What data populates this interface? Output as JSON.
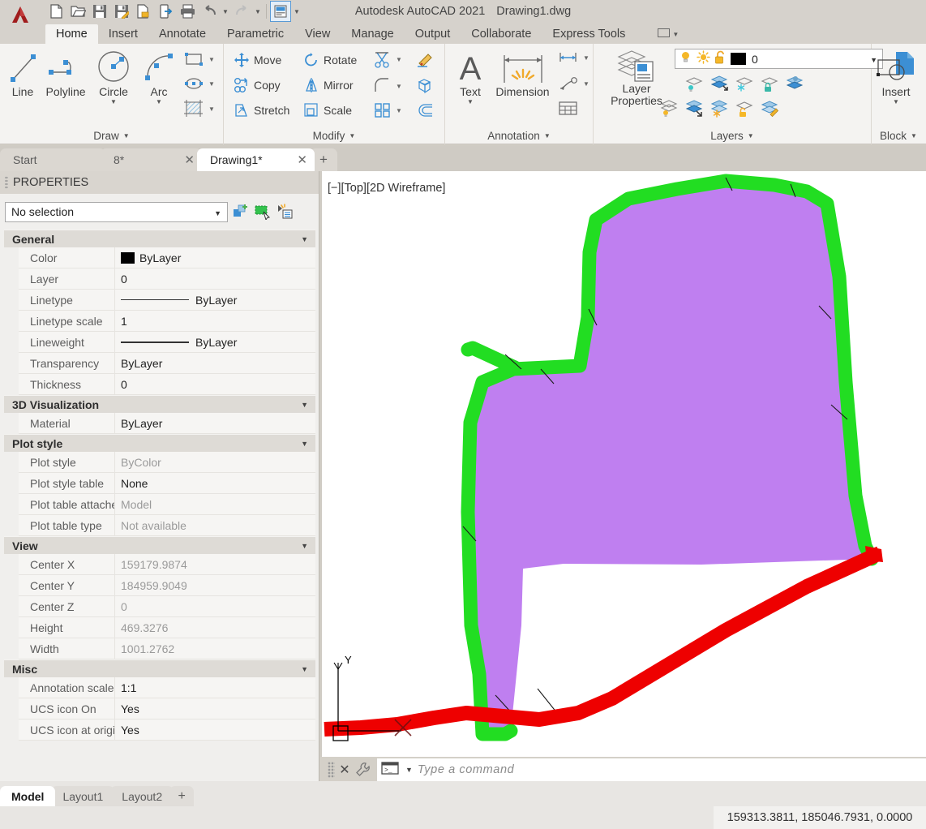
{
  "titlebar": {
    "logo": "autocad-logo",
    "product": "Autodesk AutoCAD 2021",
    "document": "Drawing1.dwg",
    "qat": [
      {
        "name": "new-icon",
        "tip": "New"
      },
      {
        "name": "open-icon",
        "tip": "Open"
      },
      {
        "name": "save-icon",
        "tip": "Save"
      },
      {
        "name": "saveas-icon",
        "tip": "Save As"
      },
      {
        "name": "save-to-web-icon",
        "tip": "Save to Web & Mobile"
      },
      {
        "name": "open-from-web-icon",
        "tip": "Open from Web & Mobile"
      },
      {
        "name": "plot-icon",
        "tip": "Plot"
      },
      {
        "name": "undo-icon",
        "tip": "Undo"
      },
      {
        "name": "redo-icon",
        "tip": "Redo"
      },
      {
        "name": "workspace-icon",
        "tip": "Workspace Switching"
      }
    ]
  },
  "ribbon": {
    "tabs": [
      {
        "label": "Home",
        "active": true
      },
      {
        "label": "Insert",
        "active": false
      },
      {
        "label": "Annotate",
        "active": false
      },
      {
        "label": "Parametric",
        "active": false
      },
      {
        "label": "View",
        "active": false
      },
      {
        "label": "Manage",
        "active": false
      },
      {
        "label": "Output",
        "active": false
      },
      {
        "label": "Collaborate",
        "active": false
      },
      {
        "label": "Express Tools",
        "active": false
      }
    ],
    "panels": [
      {
        "title": "Draw",
        "big_buttons": [
          {
            "label": "Line",
            "icon": "line-icon",
            "caret": false
          },
          {
            "label": "Polyline",
            "icon": "polyline-icon",
            "caret": false
          },
          {
            "label": "Circle",
            "icon": "circle-icon",
            "caret": true
          },
          {
            "label": "Arc",
            "icon": "arc-icon",
            "caret": true
          }
        ],
        "stack_buttons": [
          {
            "label": "",
            "icon": "rectangle-icon",
            "caret": true
          },
          {
            "label": "",
            "icon": "ellipse-icon",
            "caret": true
          },
          {
            "label": "",
            "icon": "hatch-icon",
            "caret": true
          }
        ]
      },
      {
        "title": "Modify",
        "small_buttons": [
          {
            "label": "Move",
            "icon": "move-icon"
          },
          {
            "label": "Rotate",
            "icon": "rotate-icon"
          },
          {
            "label": "Copy",
            "icon": "copy-icon"
          },
          {
            "label": "Mirror",
            "icon": "mirror-icon"
          },
          {
            "label": "Stretch",
            "icon": "stretch-icon"
          },
          {
            "label": "Scale",
            "icon": "scale-icon"
          }
        ],
        "icon_buttons": [
          {
            "icon": "trim-icon",
            "caret": true
          },
          {
            "icon": "fillet-icon",
            "caret": true
          },
          {
            "icon": "array-icon",
            "caret": true
          },
          {
            "icon": "erase-icon",
            "caret": false
          },
          {
            "icon": "explode-icon",
            "caret": false
          },
          {
            "icon": "offset-icon",
            "caret": false
          }
        ]
      },
      {
        "title": "Annotation",
        "big_buttons": [
          {
            "label": "Text",
            "icon": "text-icon",
            "caret": true
          },
          {
            "label": "Dimension",
            "icon": "dimension-icon",
            "caret": false
          }
        ],
        "icon_buttons": [
          {
            "icon": "linear-dimension-icon",
            "caret": true
          },
          {
            "icon": "leader-icon",
            "caret": true
          },
          {
            "icon": "table-icon",
            "caret": false
          }
        ]
      },
      {
        "title": "Layers",
        "big_buttons": [
          {
            "label": "Layer\nProperties",
            "icon": "layer-properties-icon",
            "caret": false
          }
        ],
        "layer_combo": {
          "name": "layer-selector",
          "value": "0",
          "color_swatch": "#000000",
          "state_icons": [
            "lightbulb-on-icon",
            "sun-icon",
            "unlock-icon"
          ]
        },
        "icon_buttons": [
          {
            "icon": "layer-isolate-icon"
          },
          {
            "icon": "layer-unisolate-icon"
          },
          {
            "icon": "layer-freeze-icon"
          },
          {
            "icon": "layer-lock-icon"
          },
          {
            "icon": "layer-merge-icon"
          },
          {
            "icon": "layer-off-icon"
          },
          {
            "icon": "layer-turn-all-on-icon"
          },
          {
            "icon": "layer-thaw-all-icon"
          },
          {
            "icon": "layer-unlock-icon"
          },
          {
            "icon": "layer-change-to-current-icon"
          }
        ]
      },
      {
        "title": "Block",
        "big_buttons": [
          {
            "label": "Insert",
            "icon": "insert-block-icon",
            "caret": true
          }
        ],
        "icon_buttons": [
          {
            "icon": "create-block-icon"
          },
          {
            "icon": "edit-block-icon"
          },
          {
            "icon": "define-attributes-icon"
          }
        ]
      }
    ]
  },
  "file_tabs": [
    {
      "label": "Start",
      "closable": false,
      "active": false
    },
    {
      "label": "8*",
      "closable": true,
      "active": false
    },
    {
      "label": "Drawing1*",
      "closable": true,
      "active": true
    }
  ],
  "file_tab_add": "+",
  "properties": {
    "title": "PROPERTIES",
    "selection": {
      "value": "No selection",
      "placeholder": "No selection"
    },
    "toolbar_icons": [
      "quick-select-icon",
      "select-objects-icon",
      "quick-properties-icon"
    ],
    "groups": [
      {
        "name": "General",
        "rows": [
          {
            "label": "Color",
            "value": "ByLayer",
            "kind": "color",
            "swatch": "#000000",
            "muted": false
          },
          {
            "label": "Layer",
            "value": "0",
            "kind": "text",
            "muted": false
          },
          {
            "label": "Linetype",
            "value": "ByLayer",
            "kind": "linetype",
            "muted": false
          },
          {
            "label": "Linetype scale",
            "value": "1",
            "kind": "text",
            "muted": false
          },
          {
            "label": "Lineweight",
            "value": "ByLayer",
            "kind": "lineweight",
            "muted": false
          },
          {
            "label": "Transparency",
            "value": "ByLayer",
            "kind": "text",
            "muted": false
          },
          {
            "label": "Thickness",
            "value": "0",
            "kind": "text",
            "muted": false
          }
        ]
      },
      {
        "name": "3D Visualization",
        "rows": [
          {
            "label": "Material",
            "value": "ByLayer",
            "kind": "text",
            "muted": false
          }
        ]
      },
      {
        "name": "Plot style",
        "rows": [
          {
            "label": "Plot style",
            "value": "ByColor",
            "kind": "text",
            "muted": true
          },
          {
            "label": "Plot style table",
            "value": "None",
            "kind": "text",
            "muted": false
          },
          {
            "label": "Plot table attached...",
            "value": "Model",
            "kind": "text",
            "muted": true
          },
          {
            "label": "Plot table type",
            "value": "Not available",
            "kind": "text",
            "muted": true
          }
        ]
      },
      {
        "name": "View",
        "rows": [
          {
            "label": "Center X",
            "value": "159179.9874",
            "kind": "text",
            "muted": true
          },
          {
            "label": "Center Y",
            "value": "184959.9049",
            "kind": "text",
            "muted": true
          },
          {
            "label": "Center Z",
            "value": "0",
            "kind": "text",
            "muted": true
          },
          {
            "label": "Height",
            "value": "469.3276",
            "kind": "text",
            "muted": true
          },
          {
            "label": "Width",
            "value": "1001.2762",
            "kind": "text",
            "muted": true
          }
        ]
      },
      {
        "name": "Misc",
        "rows": [
          {
            "label": "Annotation scale",
            "value": "1:1",
            "kind": "text",
            "muted": false
          },
          {
            "label": "UCS icon On",
            "value": "Yes",
            "kind": "text",
            "muted": false
          },
          {
            "label": "UCS icon at origin",
            "value": "Yes",
            "kind": "text",
            "muted": false
          }
        ]
      }
    ]
  },
  "canvas": {
    "viewport_label": "[−][Top][2D Wireframe]",
    "background": "#ffffff",
    "ucs_icon": {
      "name": "ucs-icon",
      "axis_label": "Y"
    },
    "shapes": {
      "parcel_fill": "#bf7ff0",
      "boundary_green": "#22dd22",
      "boundary_red": "#ee0000"
    }
  },
  "command_line": {
    "placeholder": "Type a command",
    "value": "",
    "icons": [
      "close-icon",
      "customize-icon",
      "command-history-icon",
      "chevron-down-icon"
    ]
  },
  "bottom": {
    "layout_tabs": [
      {
        "label": "Model",
        "active": true
      },
      {
        "label": "Layout1",
        "active": false
      },
      {
        "label": "Layout2",
        "active": false
      }
    ],
    "layout_add": "+",
    "coordinates": "159313.3811, 185046.7931, 0.0000"
  }
}
